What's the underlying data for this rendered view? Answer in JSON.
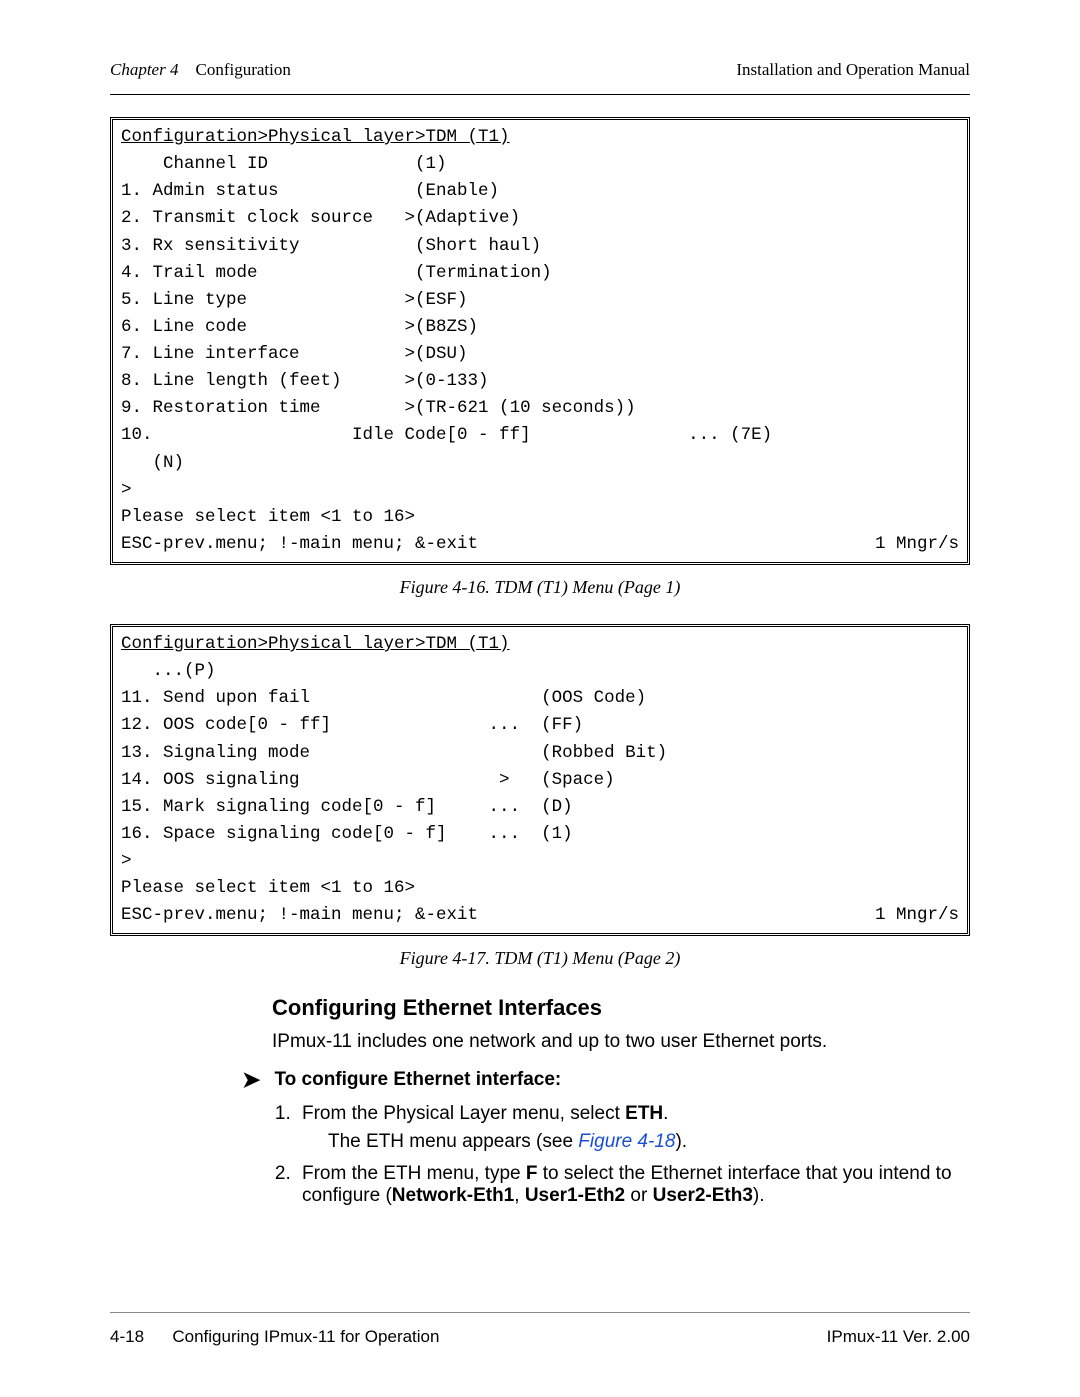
{
  "header": {
    "chapter_label": "Chapter 4",
    "chapter_name": "Configuration",
    "right": "Installation and Operation Manual"
  },
  "menu1": {
    "breadcrumb": "Configuration>Physical layer>TDM (T1)",
    "line_channel": "    Channel ID              (1)",
    "items": [
      "1. Admin status             (Enable)",
      "2. Transmit clock source   >(Adaptive)",
      "3. Rx sensitivity           (Short haul)",
      "4. Trail mode               (Termination)",
      "5. Line type               >(ESF)",
      "6. Line code               >(B8ZS)",
      "7. Line interface          >(DSU)",
      "8. Line length (feet)      >(0-133)",
      "9. Restoration time        >(TR-621 (10 seconds))",
      "10.                   Idle Code[0 - ff]               ... (7E)",
      "   (N)"
    ],
    "prompt": ">",
    "select_prompt": "Please select item <1 to 16>",
    "footer_left": "ESC-prev.menu; !-main menu; &-exit",
    "footer_right": "1 Mngr/s"
  },
  "caption1": "Figure 4-16.  TDM (T1) Menu (Page 1)",
  "menu2": {
    "breadcrumb": "Configuration>Physical layer>TDM (T1)",
    "cont": "   ...(P)",
    "items": [
      "11. Send upon fail                      (OOS Code)",
      "12. OOS code[0 - ff]               ...  (FF)",
      "13. Signaling mode                      (Robbed Bit)",
      "14. OOS signaling                   >   (Space)",
      "15. Mark signaling code[0 - f]     ...  (D)",
      "16. Space signaling code[0 - f]    ...  (1)"
    ],
    "prompt": ">",
    "select_prompt": "Please select item <1 to 16>",
    "footer_left": "ESC-prev.menu; !-main menu; &-exit",
    "footer_right": "1 Mngr/s"
  },
  "caption2": "Figure 4-17.  TDM (T1) Menu (Page 2)",
  "section": {
    "heading": "Configuring Ethernet Interfaces",
    "intro": "IPmux-11 includes one network and up to two user Ethernet ports.",
    "proc_heading": "To configure Ethernet interface:",
    "step1_pre": "From the Physical Layer menu, select ",
    "step1_bold": "ETH",
    "step1_post": ".",
    "step1_sub_pre": "The ETH menu appears (see ",
    "step1_sub_link": "Figure 4-18",
    "step1_sub_post": ").",
    "step2_pre": "From the ETH menu, type ",
    "step2_bold1": "F",
    "step2_mid": " to select the Ethernet interface that you intend to configure (",
    "step2_b2": "Network-Eth1",
    "step2_c1": ", ",
    "step2_b3": "User1-Eth2",
    "step2_c2": " or ",
    "step2_b4": "User2-Eth3",
    "step2_end": ")."
  },
  "footer": {
    "page": "4-18",
    "title": "Configuring IPmux-11 for Operation",
    "product": "IPmux-11 Ver. 2.00"
  }
}
